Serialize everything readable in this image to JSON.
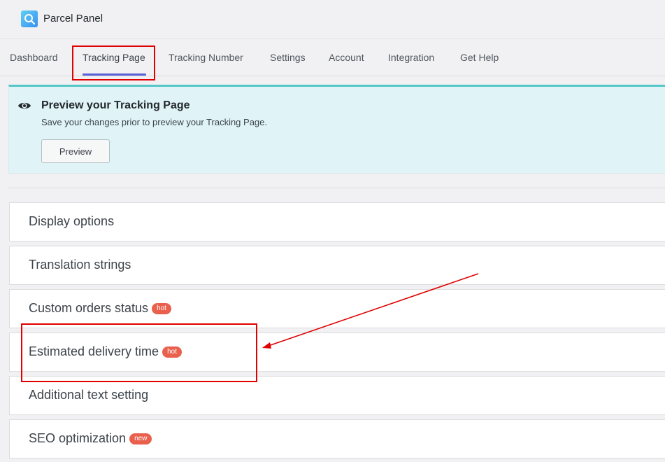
{
  "app": {
    "title": "Parcel Panel"
  },
  "tabs": [
    {
      "label": "Dashboard"
    },
    {
      "label": "Tracking Page"
    },
    {
      "label": "Tracking Number"
    },
    {
      "label": "Settings"
    },
    {
      "label": "Account"
    },
    {
      "label": "Integration"
    },
    {
      "label": "Get Help"
    }
  ],
  "notice": {
    "title": "Preview your Tracking Page",
    "text": "Save your changes prior to preview your Tracking Page.",
    "button_label": "Preview"
  },
  "sections": [
    {
      "label": "Display options"
    },
    {
      "label": "Translation strings"
    },
    {
      "label": "Custom orders status",
      "badge": "hot"
    },
    {
      "label": "Estimated delivery time",
      "badge": "hot"
    },
    {
      "label": "Additional text setting"
    },
    {
      "label": "SEO optimization",
      "badge": "new"
    }
  ],
  "colors": {
    "accent": "#5a5fd6",
    "notice_bg": "#e0f4f7",
    "notice_border": "#56c6c6",
    "badge": "#e9604d",
    "annotation": "#e00000"
  }
}
